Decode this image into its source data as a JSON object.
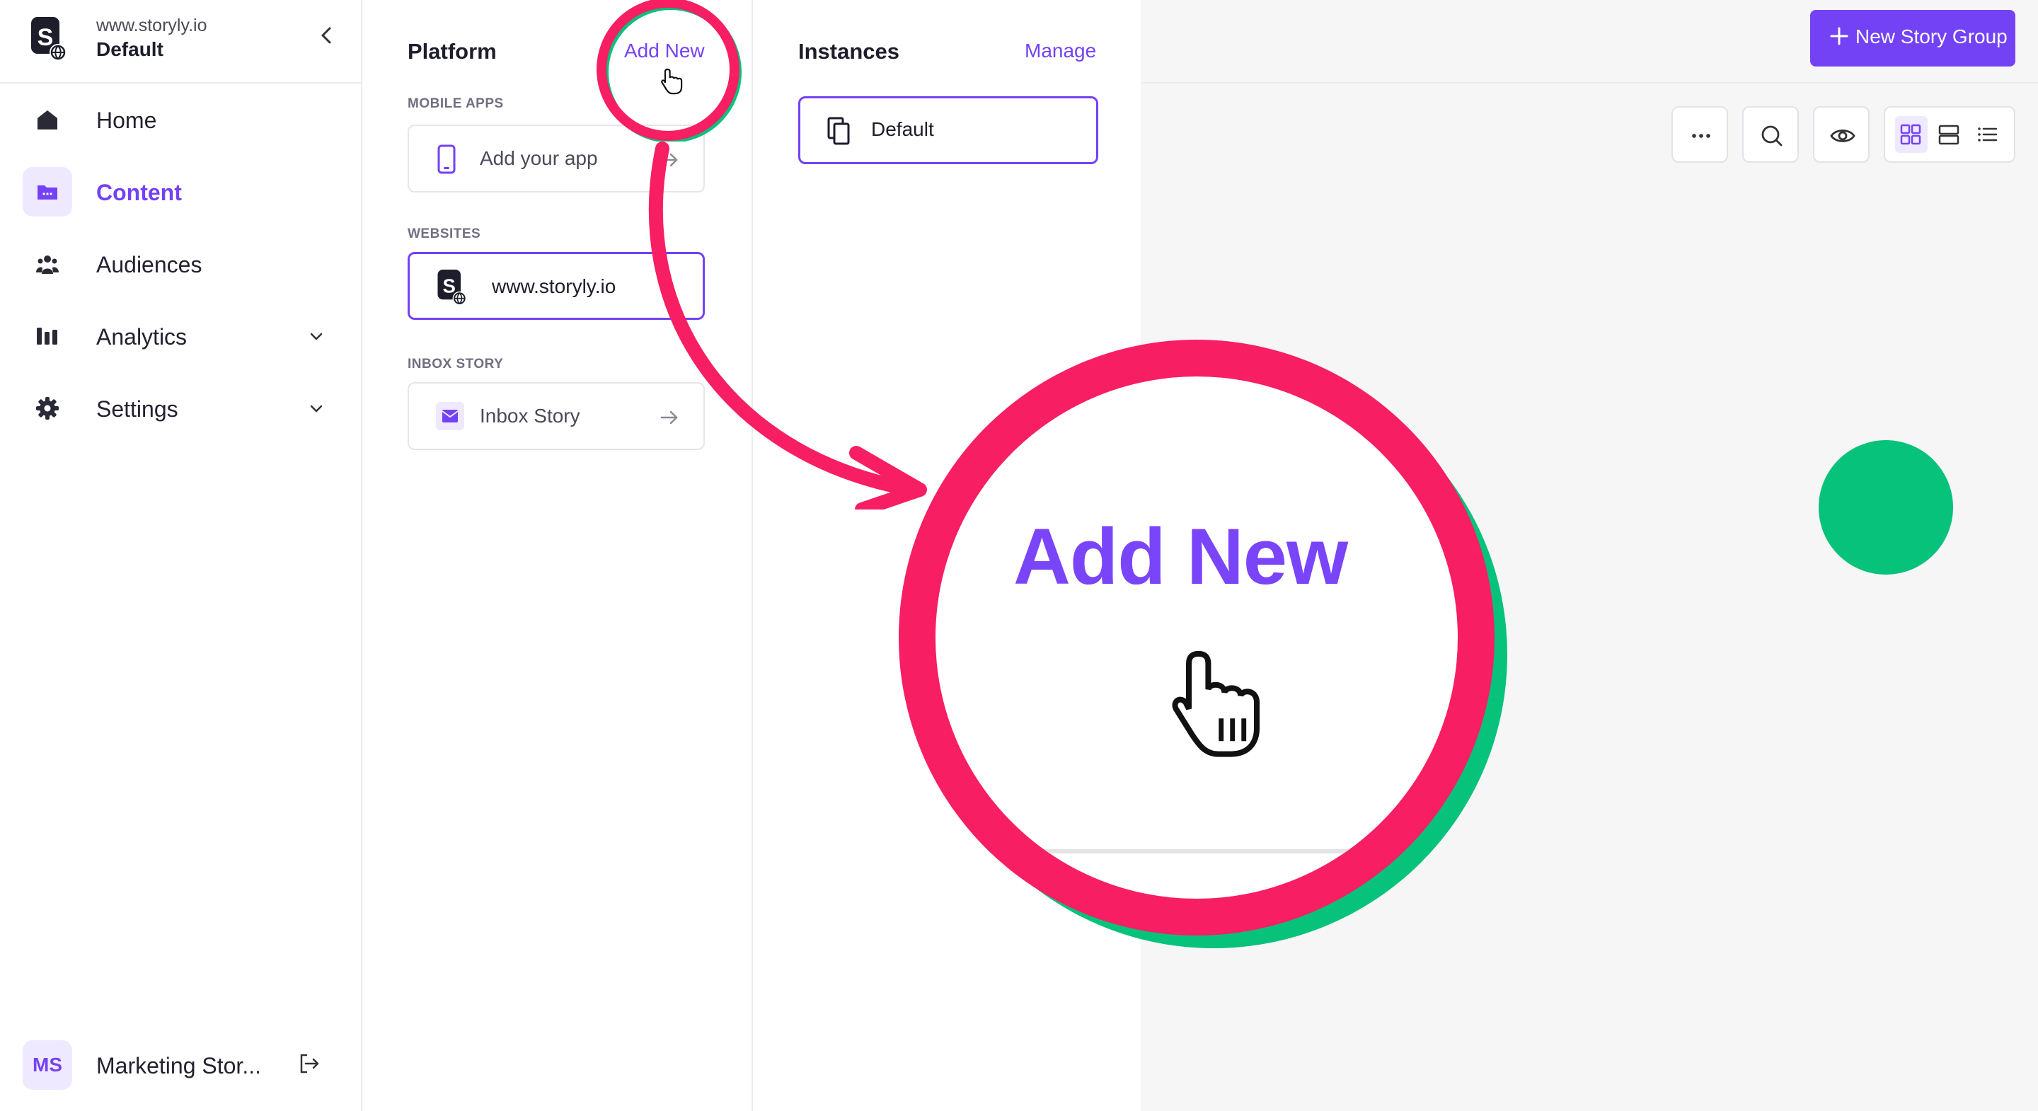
{
  "workspace": {
    "domain": "www.storyly.io",
    "name": "Default"
  },
  "nav": {
    "items": [
      {
        "label": "Home",
        "icon": "home-icon",
        "active": false,
        "expandable": false
      },
      {
        "label": "Content",
        "icon": "folder-icon",
        "active": true,
        "expandable": false
      },
      {
        "label": "Audiences",
        "icon": "people-icon",
        "active": false,
        "expandable": false
      },
      {
        "label": "Analytics",
        "icon": "bar-chart-icon",
        "active": false,
        "expandable": true
      },
      {
        "label": "Settings",
        "icon": "gear-icon",
        "active": false,
        "expandable": true
      }
    ]
  },
  "user": {
    "initials": "MS",
    "name": "Marketing Stor..."
  },
  "platform": {
    "title": "Platform",
    "add_new": "Add New",
    "sections": {
      "mobile_apps": {
        "label": "MOBILE APPS",
        "card": "Add your app"
      },
      "websites": {
        "label": "WEBSITES",
        "card": "www.storyly.io"
      },
      "inbox_story": {
        "label": "INBOX STORY",
        "card": "Inbox Story"
      }
    }
  },
  "instances": {
    "title": "Instances",
    "manage": "Manage",
    "items": [
      "Default"
    ]
  },
  "toolbar": {
    "new_story_group": "New Story Group"
  },
  "zoom_callout": {
    "text": "Add New"
  },
  "colors": {
    "accent": "#7442f5",
    "annotation_pink": "#f71e63",
    "annotation_green": "#06c27a"
  }
}
